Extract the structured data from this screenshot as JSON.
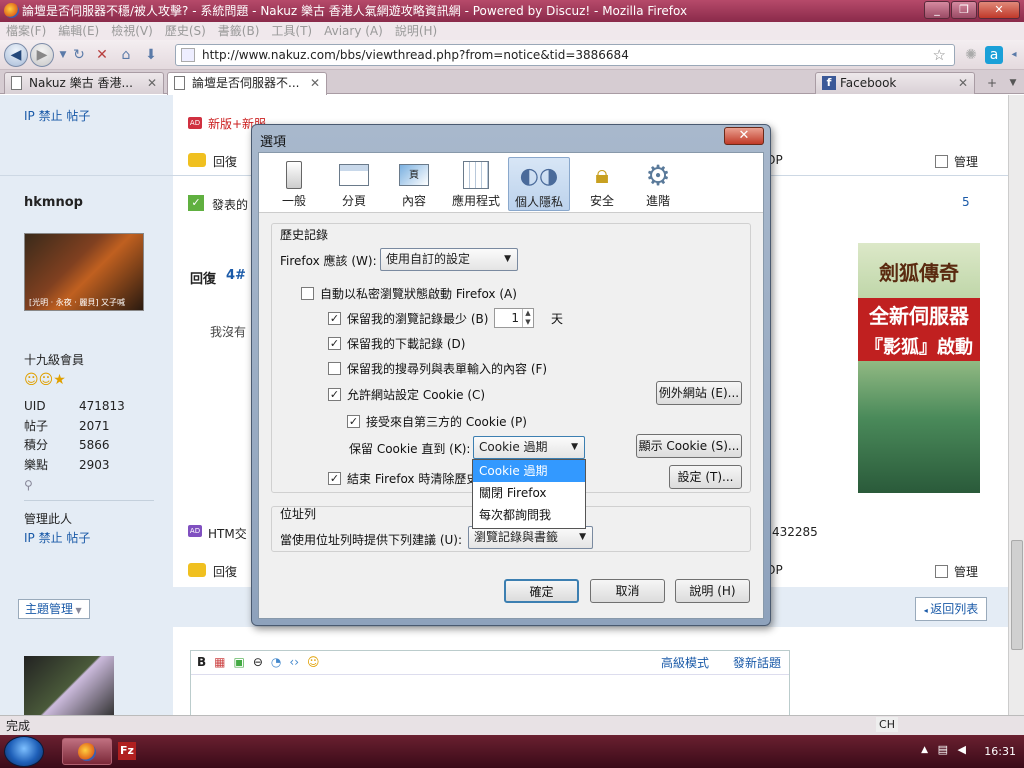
{
  "window": {
    "title": "論壇是否伺服器不穩/被人攻擊? - 系統問題 - Nakuz 樂古 香港人氣網遊攻略資訊網 - Powered by Discuz! - Mozilla Firefox"
  },
  "menu": [
    "檔案(F)",
    "編輯(E)",
    "檢視(V)",
    "歷史(S)",
    "書籤(B)",
    "工具(T)",
    "Aviary (A)",
    "說明(H)"
  ],
  "url": "http://www.nakuz.com/bbs/viewthread.php?from=notice&tid=3886684",
  "tabs": [
    {
      "label": "Nakuz 樂古 香港..."
    },
    {
      "label": "論壇是否伺服器不..."
    },
    {
      "label": "Facebook"
    }
  ],
  "forum": {
    "ip_ban_posts_top": "IP  禁止  帖子",
    "ad_top": "新版+新服，無法抗拒的webgame《明朝時代》，美女紫玲等你一起來遊戲！",
    "reply": "回復",
    "manage": "管理",
    "reply_partial_right": "OP",
    "post_comment": "發表的",
    "post_num": "5",
    "username": "hkmnop",
    "avatar_caption": "[光明 · 永夜 · 麗貝] 又子喊",
    "reply_heading": "回復",
    "reply_floor": "4#",
    "body_partial": "我沒有",
    "rank": "十九級會員",
    "stats": [
      {
        "k": "UID",
        "v": "471813"
      },
      {
        "k": "帖子",
        "v": "2071"
      },
      {
        "k": "積分",
        "v": "5866"
      },
      {
        "k": "樂點",
        "v": "2903"
      }
    ],
    "admin_label": "管理此人",
    "ip_ban_posts": "IP  禁止  帖子",
    "ad_bottom": "HTM交",
    "ad_bottom_num": "432285",
    "theme_manage": "主題管理",
    "back_list": "返回列表",
    "advanced_mode": "高級模式",
    "new_topic": "發新話題",
    "banner_title": "劍狐傳奇",
    "banner_line1": "全新伺服器",
    "banner_line2": "『影狐』啟動"
  },
  "status": "完成",
  "tray": {
    "lang": "CH",
    "time": "16:31"
  },
  "dialog": {
    "title": "選項",
    "toolbar": [
      {
        "label": "一般",
        "icon": "switch-icon"
      },
      {
        "label": "分頁",
        "icon": "tabs-icon"
      },
      {
        "label": "內容",
        "icon": "content-icon"
      },
      {
        "label": "應用程式",
        "icon": "applications-icon"
      },
      {
        "label": "個人隱私",
        "icon": "mask-icon"
      },
      {
        "label": "安全",
        "icon": "lock-icon"
      },
      {
        "label": "進階",
        "icon": "gear-icon"
      }
    ],
    "history_group": "歷史記錄",
    "firefox_will": "Firefox 應該 (W):",
    "history_mode": "使用自訂的設定",
    "auto_private": "自動以私密瀏覽狀態啟動 Firefox (A)",
    "keep_history": "保留我的瀏覽記錄最少 (B)",
    "history_days": "1",
    "days_unit": "天",
    "keep_downloads": "保留我的下載記錄 (D)",
    "keep_search": "保留我的搜尋列與表單輸入的內容 (F)",
    "allow_cookies": "允許網站設定 Cookie (C)",
    "exceptions": "例外網站 (E)...",
    "third_party": "接受來自第三方的 Cookie (P)",
    "keep_until": "保留 Cookie 直到 (K):",
    "keep_until_value": "Cookie 過期",
    "show_cookies": "顯示 Cookie (S)...",
    "clear_on_close": "結束 Firefox 時清除歷史",
    "settings": "設定 (T)...",
    "dropdown_options": [
      "Cookie 過期",
      "關閉 Firefox",
      "每次都詢問我"
    ],
    "locationbar_group": "位址列",
    "locationbar_label": "當使用位址列時提供下列建議 (U):",
    "locationbar_value": "瀏覽記錄與書籤",
    "ok": "確定",
    "cancel": "取消",
    "help": "說明 (H)"
  }
}
